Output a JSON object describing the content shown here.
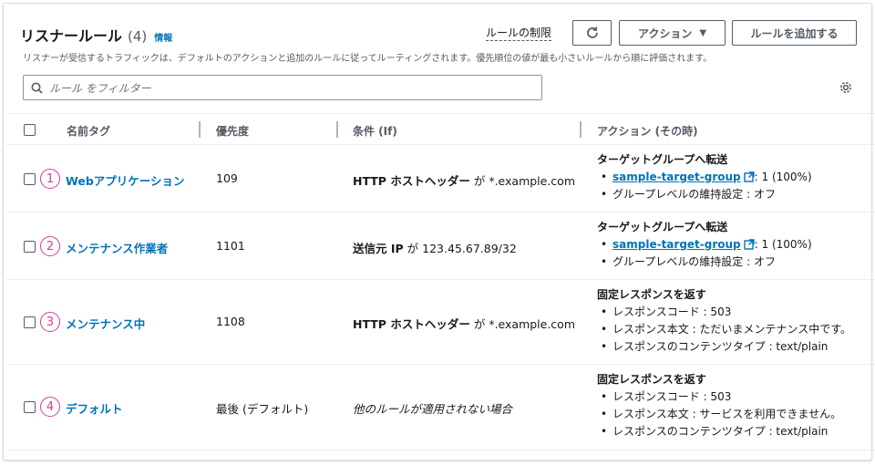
{
  "header": {
    "title": "リスナールール",
    "count": "(4)",
    "info": "情報",
    "rule_limit": "ルールの制限",
    "actions_label": "アクション",
    "add_rule_label": "ルールを追加する",
    "description": "リスナーが受信するトラフィックは、デフォルトのアクションと追加のルールに従ってルーティングされます。優先順位の値が最も小さいルールから順に評価されます。"
  },
  "search": {
    "placeholder": "ルール をフィルター"
  },
  "table": {
    "columns": [
      "名前タグ",
      "優先度",
      "条件 (If)",
      "アクション (その時)"
    ],
    "rows": [
      {
        "index": "1",
        "name": "Webアプリケーション",
        "priority": "109",
        "cond_prefix": "HTTP ホストヘッダー",
        "cond_mid": "が",
        "cond_value": "*.example.com",
        "action_title": "ターゲットグループへ転送",
        "target_group": "sample-target-group",
        "target_weight": ": 1 (100%)",
        "stickiness": "グループレベルの維持設定 : オフ"
      },
      {
        "index": "2",
        "name": "メンテナンス作業者",
        "priority": "1101",
        "cond_prefix": "送信元 IP",
        "cond_mid": "が",
        "cond_value": "123.45.67.89/32",
        "action_title": "ターゲットグループへ転送",
        "target_group": "sample-target-group",
        "target_weight": ": 1 (100%)",
        "stickiness": "グループレベルの維持設定 : オフ"
      },
      {
        "index": "3",
        "name": "メンテナンス中",
        "priority": "1108",
        "cond_prefix": "HTTP ホストヘッダー",
        "cond_mid": "が",
        "cond_value": "*.example.com",
        "action_title": "固定レスポンスを返す",
        "response_code": "レスポンスコード : 503",
        "response_body": "レスポンス本文 : ただいまメンテナンス中です。",
        "content_type": "レスポンスのコンテンツタイプ : text/plain"
      },
      {
        "index": "4",
        "name": "デフォルト",
        "priority": "最後 (デフォルト)",
        "condition_text": "他のルールが適用されない場合",
        "action_title": "固定レスポンスを返す",
        "response_code": "レスポンスコード : 503",
        "response_body": "レスポンス本文 : サービスを利用できません。",
        "content_type": "レスポンスのコンテンツタイプ : text/plain"
      }
    ]
  },
  "colors": {
    "link": "#0073bb",
    "annotation": "#d63b94"
  }
}
